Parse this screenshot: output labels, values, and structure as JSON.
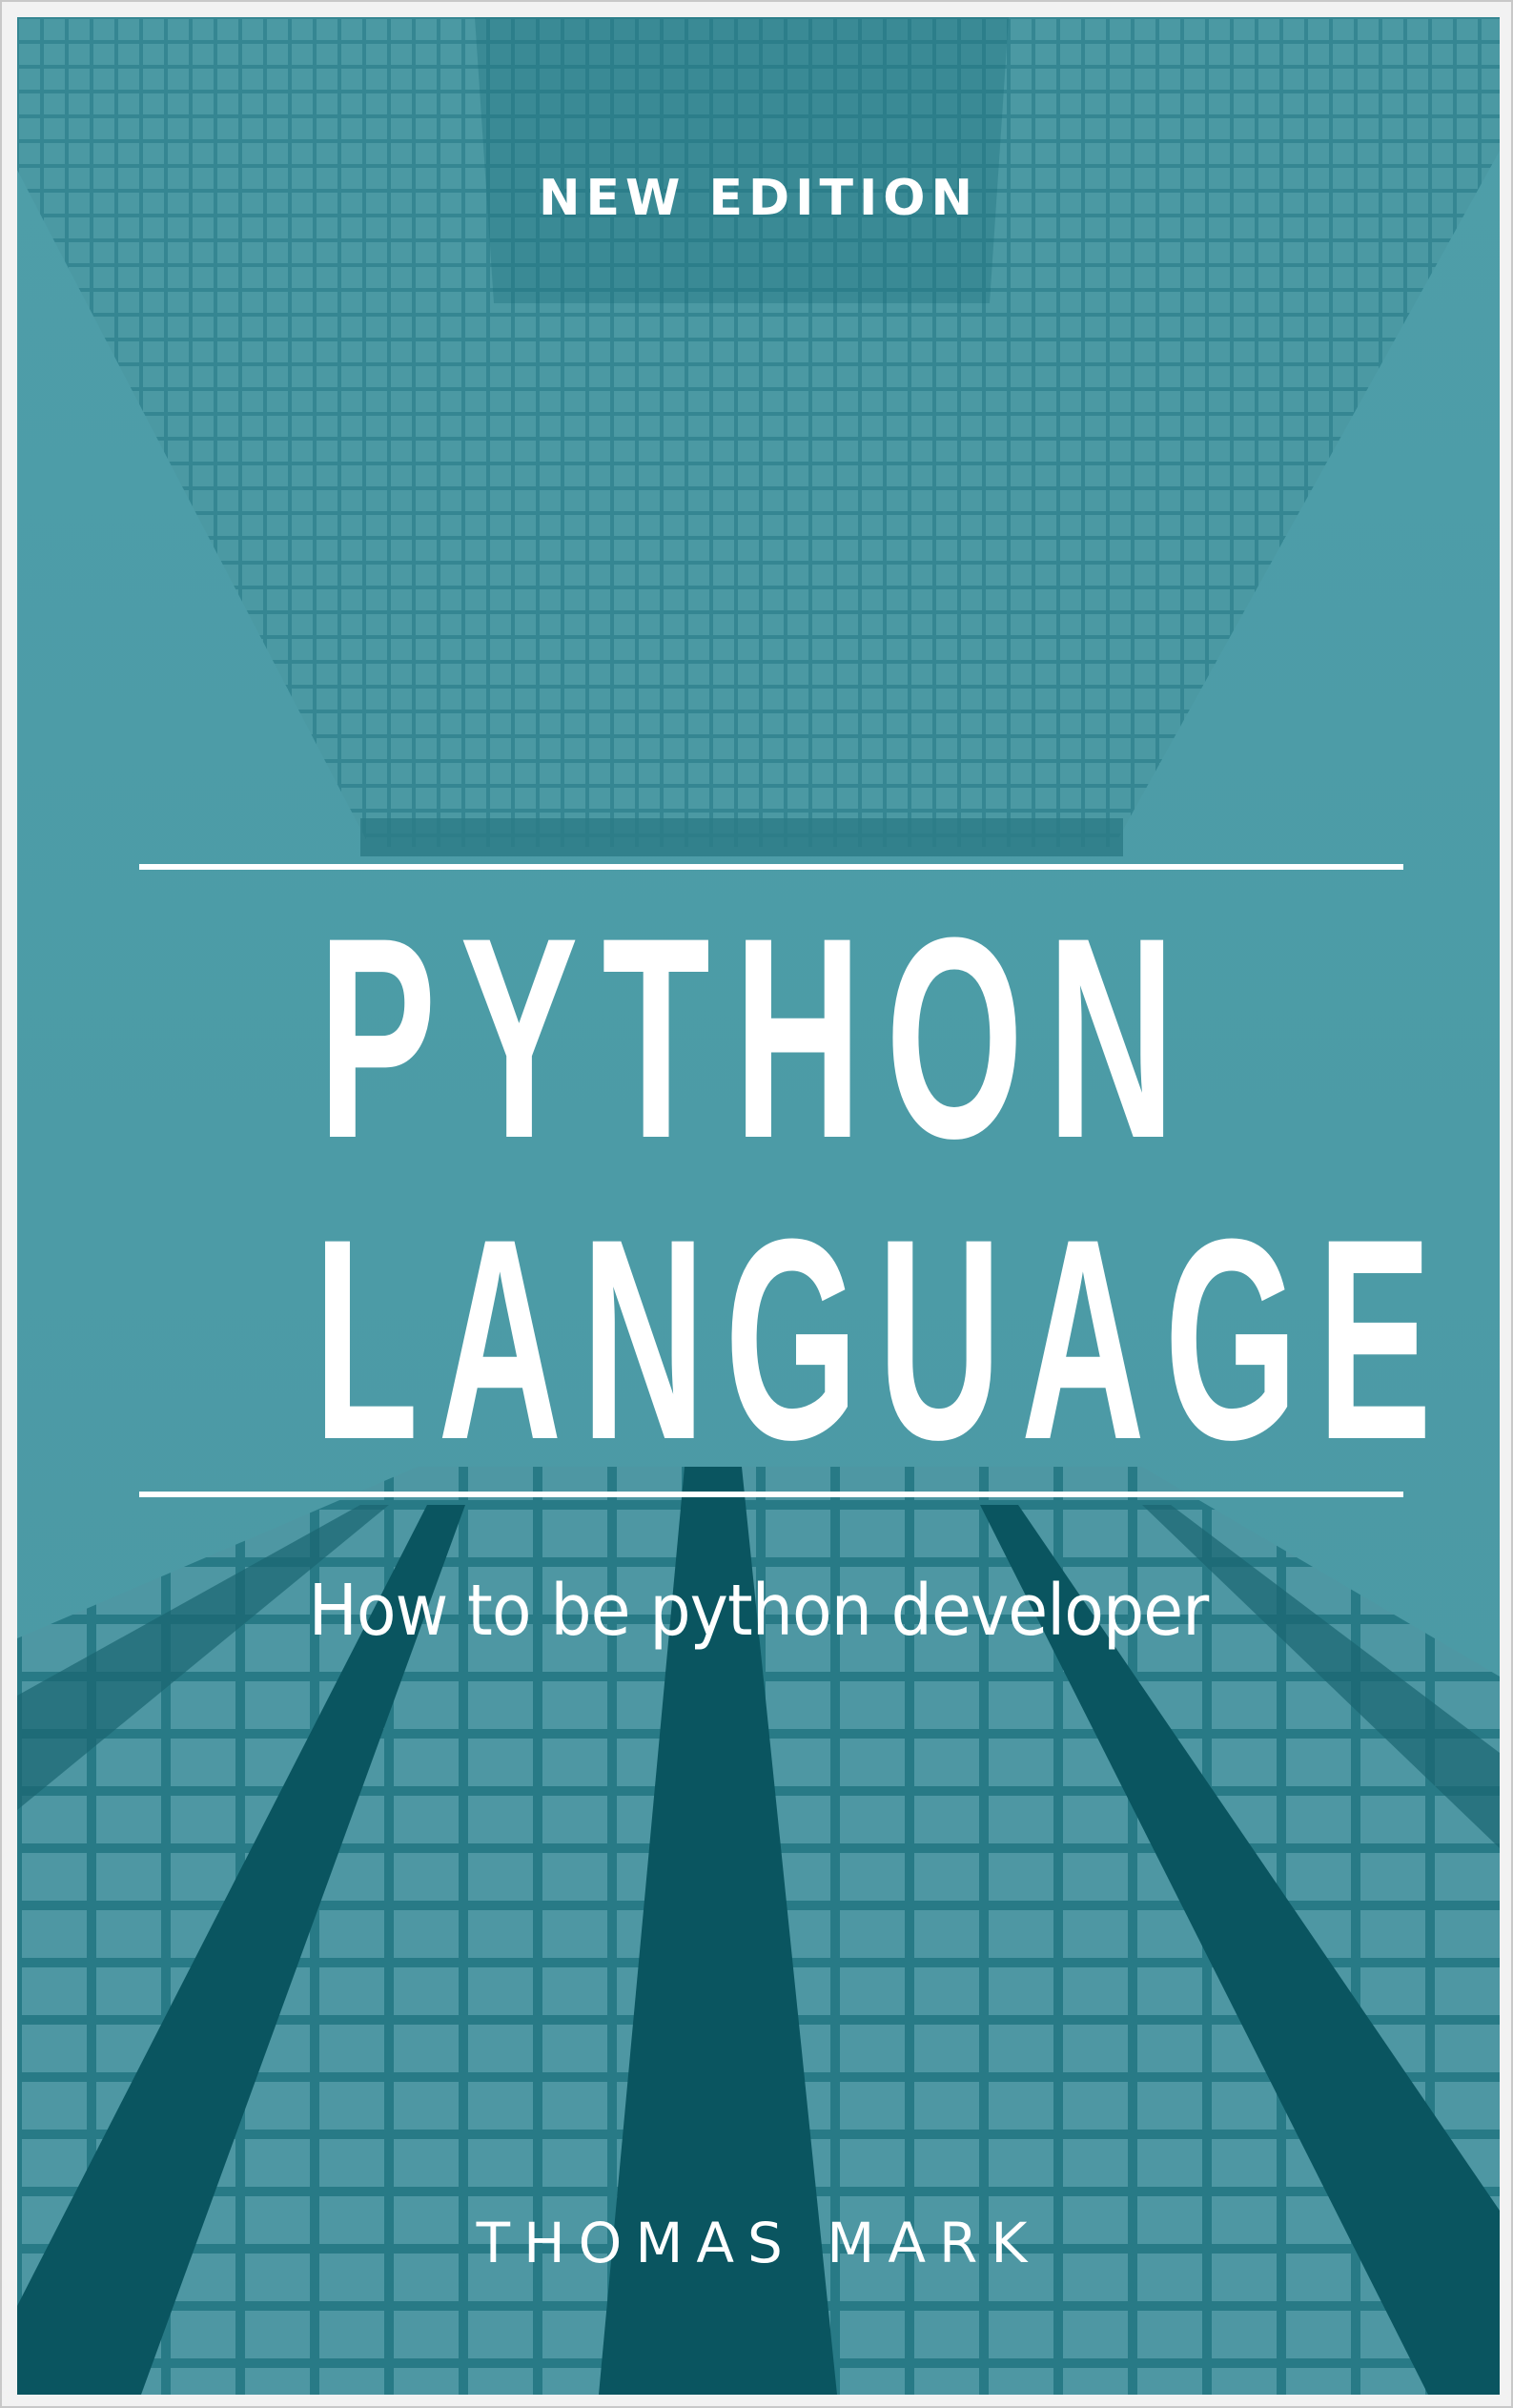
{
  "cover": {
    "edition": "NEW EDITION",
    "title_line_1": "PYTHON",
    "title_line_2": "LANGUAGE",
    "subtitle": "How to be python developer",
    "author": "THOMAS MARK"
  },
  "colors": {
    "teal_light": "#4a9aa6",
    "teal_dark": "#005a66",
    "text": "#ffffff"
  },
  "background_image": "skyscraper-facade-photo"
}
